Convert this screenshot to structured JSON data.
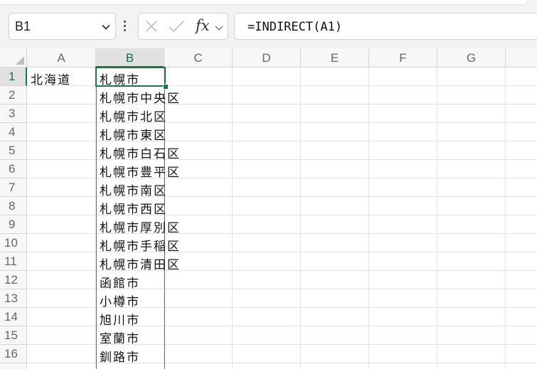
{
  "name_box": {
    "value": "B1"
  },
  "formula_bar": {
    "formula": "=INDIRECT(A1)",
    "cancel_icon": "close-icon",
    "enter_icon": "check-icon",
    "function_label": "fx"
  },
  "columns": [
    "A",
    "B",
    "C",
    "D",
    "E",
    "F",
    "G",
    ""
  ],
  "selected_column": "B",
  "rows": [
    "1",
    "2",
    "3",
    "4",
    "5",
    "6",
    "7",
    "8",
    "9",
    "10",
    "11",
    "12",
    "13",
    "14",
    "15",
    "16"
  ],
  "selected_row": "1",
  "cells": {
    "A1": "北海道",
    "B1": "札幌市",
    "B2": "札幌市中央区",
    "B3": "札幌市北区",
    "B4": "札幌市東区",
    "B5": "札幌市白石区",
    "B6": "札幌市豊平区",
    "B7": "札幌市南区",
    "B8": "札幌市西区",
    "B9": "札幌市厚別区",
    "B10": "札幌市手稲区",
    "B11": "札幌市清田区",
    "B12": "函館市",
    "B13": "小樽市",
    "B14": "旭川市",
    "B15": "室蘭市",
    "B16": "釧路市"
  },
  "colors": {
    "selection": "#1e7145",
    "header_bg": "#f7f7f7",
    "gridline": "#e2e2e2"
  }
}
